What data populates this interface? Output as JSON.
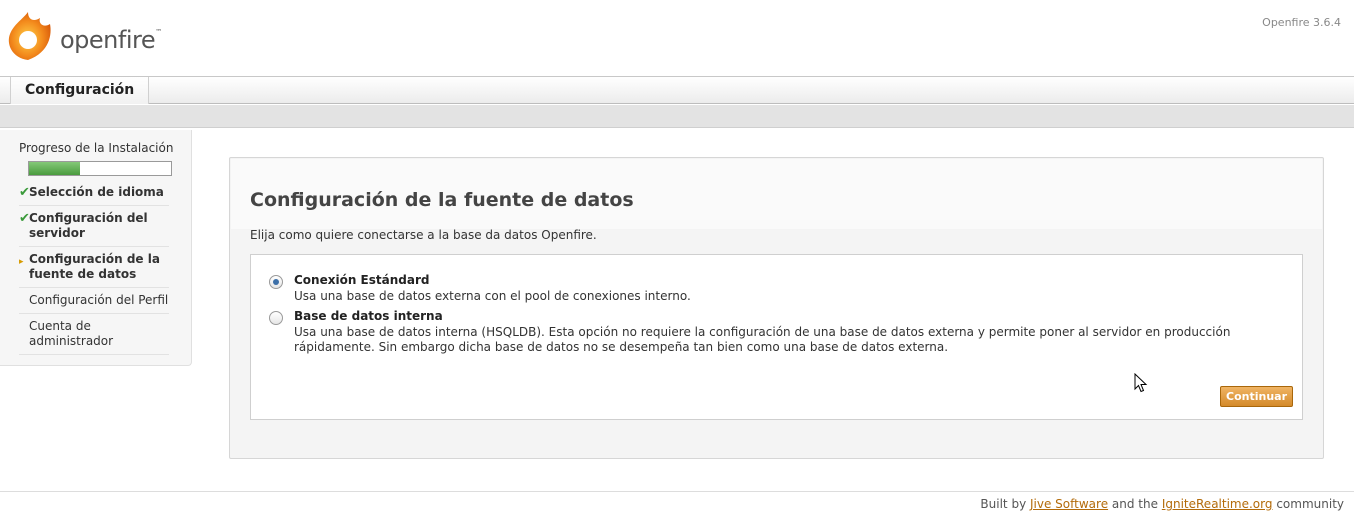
{
  "header": {
    "logo_text": "openfire",
    "logo_tm": "™",
    "version": "Openfire 3.6.4"
  },
  "tabs": [
    {
      "label": "Configuración"
    }
  ],
  "sidebar": {
    "progress_title": "Progreso de la Instalación",
    "progress_fraction": 0.36,
    "steps": [
      {
        "label": "Selección de idioma",
        "status": "done"
      },
      {
        "label": "Configuración del servidor",
        "status": "done"
      },
      {
        "label": "Configuración de la fuente de datos",
        "status": "current"
      },
      {
        "label": "Configuración del Perfil",
        "status": "pending"
      },
      {
        "label": "Cuenta de administrador",
        "status": "pending"
      }
    ]
  },
  "main": {
    "title": "Configuración de la fuente de datos",
    "description": "Elija como quiere conectarse a la base da datos Openfire.",
    "options": [
      {
        "label": "Conexión Estándard",
        "description": "Usa una base de datos externa con el pool de conexiones interno.",
        "selected": true
      },
      {
        "label": "Base de datos interna",
        "description": "Usa una base de datos interna (HSQLDB). Esta opción no requiere la configuración de una base de datos externa y permite poner al servidor en producción rápidamente. Sin embargo dicha base de datos no se desempeña tan bien como una base de datos externa.",
        "selected": false
      }
    ],
    "continue_label": "Continuar"
  },
  "footer": {
    "prefix": "Built by",
    "link1": "Jive Software",
    "middle": "and the",
    "link2": "IgniteRealtime.org",
    "suffix": "community"
  },
  "colors": {
    "accent": "#d48a2a",
    "progress": "#4a9b3e",
    "link": "#b36b0a"
  }
}
